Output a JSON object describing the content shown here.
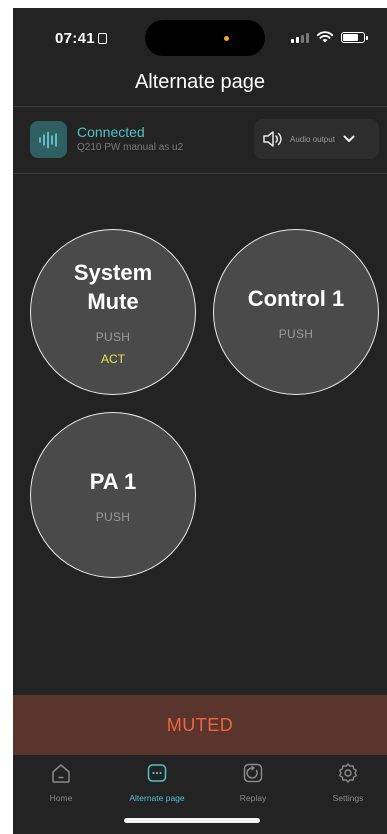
{
  "status_bar": {
    "time": "07:41"
  },
  "header": {
    "title": "Alternate page"
  },
  "connection": {
    "status": "Connected",
    "device": "Q210 PW manual as u2",
    "audio_output_label": "Audio output",
    "icons": {
      "device": "waveform-icon",
      "audio": "speaker-icon",
      "dropdown": "chevron-down-icon"
    }
  },
  "buttons": [
    {
      "label": "System Mute",
      "mode": "PUSH",
      "state": "ACT"
    },
    {
      "label": "Control 1",
      "mode": "PUSH",
      "state": ""
    },
    {
      "label": "PA 1",
      "mode": "PUSH",
      "state": ""
    }
  ],
  "mute_bar": {
    "label": "MUTED"
  },
  "tabs": [
    {
      "label": "Home",
      "icon": "home-icon",
      "active": false
    },
    {
      "label": "Alternate page",
      "icon": "alternate-page-icon",
      "active": true
    },
    {
      "label": "Replay",
      "icon": "replay-icon",
      "active": false
    },
    {
      "label": "Settings",
      "icon": "gear-icon",
      "active": false
    }
  ],
  "colors": {
    "background": "#232323",
    "accent": "#4fc3c8",
    "muted_text": "#f0643e",
    "muted_bar": "#5a352e",
    "active_state": "#e6e34a"
  }
}
